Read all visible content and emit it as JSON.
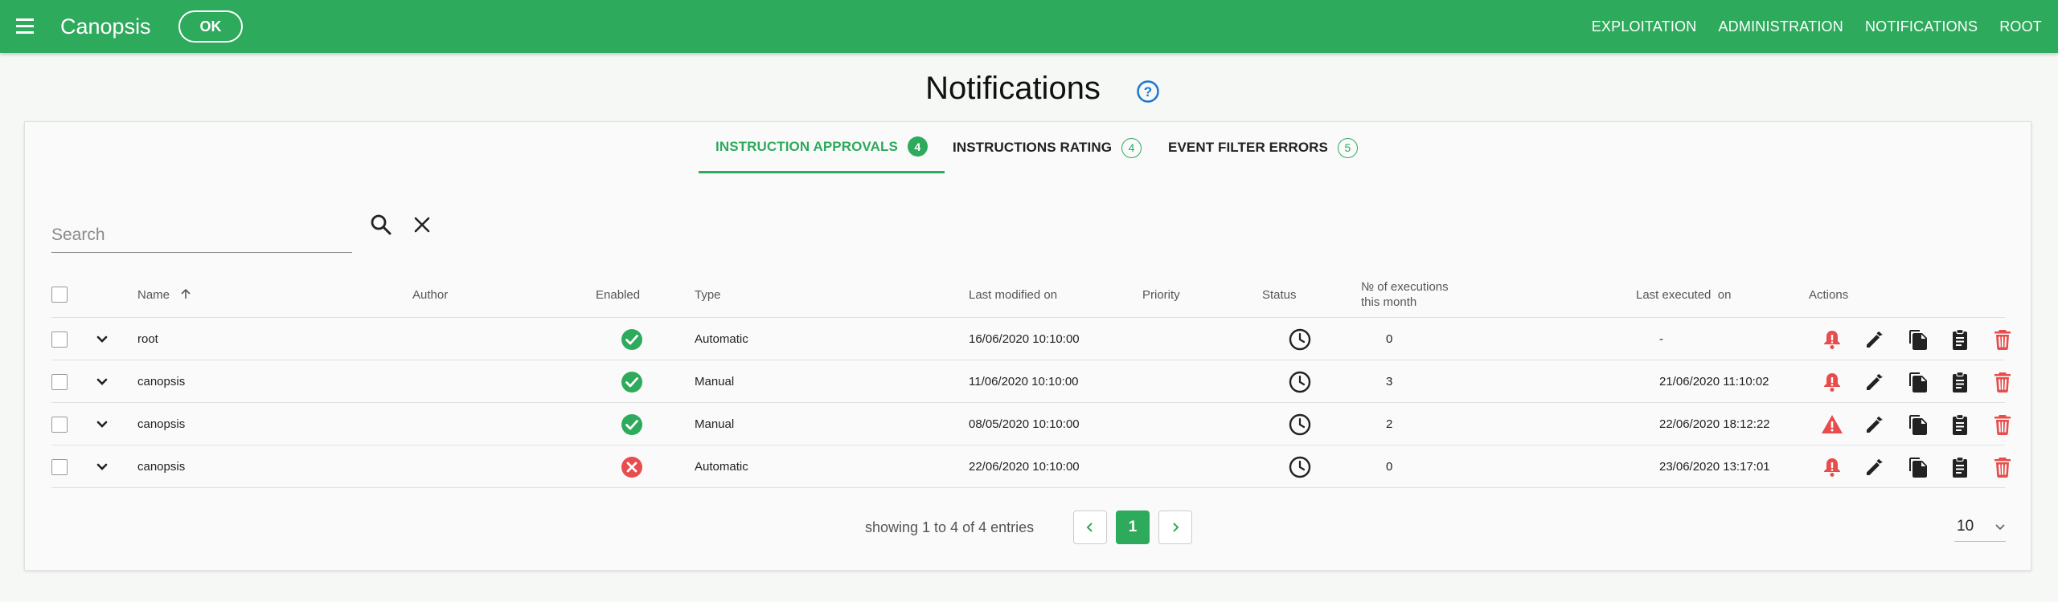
{
  "app": {
    "title": "Canopsis",
    "ok_label": "OK"
  },
  "topnav": [
    "EXPLOITATION",
    "ADMINISTRATION",
    "NOTIFICATIONS",
    "ROOT"
  ],
  "page": {
    "title": "Notifications"
  },
  "tabs": [
    {
      "label": "INSTRUCTION APPROVALS",
      "count": "4",
      "active": true
    },
    {
      "label": "INSTRUCTIONS RATING",
      "count": "4",
      "active": false
    },
    {
      "label": "EVENT FILTER ERRORS",
      "count": "5",
      "active": false
    }
  ],
  "search": {
    "placeholder": "Search",
    "value": ""
  },
  "table": {
    "headers": {
      "name": "Name",
      "author": "Author",
      "enabled": "Enabled",
      "type": "Type",
      "last_modified": "Last modified on",
      "priority": "Priority",
      "status": "Status",
      "executions_line1": "№ of executions",
      "executions_line2": "this month",
      "last_executed": "Last executed  on",
      "actions": "Actions"
    },
    "rows": [
      {
        "name": "root",
        "author": "",
        "enabled": true,
        "type": "Automatic",
        "last_modified": "16/06/2020 10:10:00",
        "priority": "",
        "executions": "0",
        "last_executed": "-",
        "alert": "bell"
      },
      {
        "name": "canopsis",
        "author": "",
        "enabled": true,
        "type": "Manual",
        "last_modified": "11/06/2020 10:10:00",
        "priority": "",
        "executions": "3",
        "last_executed": "21/06/2020 11:10:02",
        "alert": "bell"
      },
      {
        "name": "canopsis",
        "author": "",
        "enabled": true,
        "type": "Manual",
        "last_modified": "08/05/2020 10:10:00",
        "priority": "",
        "executions": "2",
        "last_executed": "22/06/2020 18:12:22",
        "alert": "warning"
      },
      {
        "name": "canopsis",
        "author": "",
        "enabled": false,
        "type": "Automatic",
        "last_modified": "22/06/2020 10:10:00",
        "priority": "",
        "executions": "0",
        "last_executed": "23/06/2020 13:17:01",
        "alert": "bell"
      }
    ]
  },
  "pagination": {
    "showing": "showing 1 to 4 of 4 entries",
    "current_page": "1",
    "per_page": "10"
  },
  "colors": {
    "primary": "#2eaa5c",
    "danger": "#e84c4c",
    "help": "#1976d2"
  }
}
